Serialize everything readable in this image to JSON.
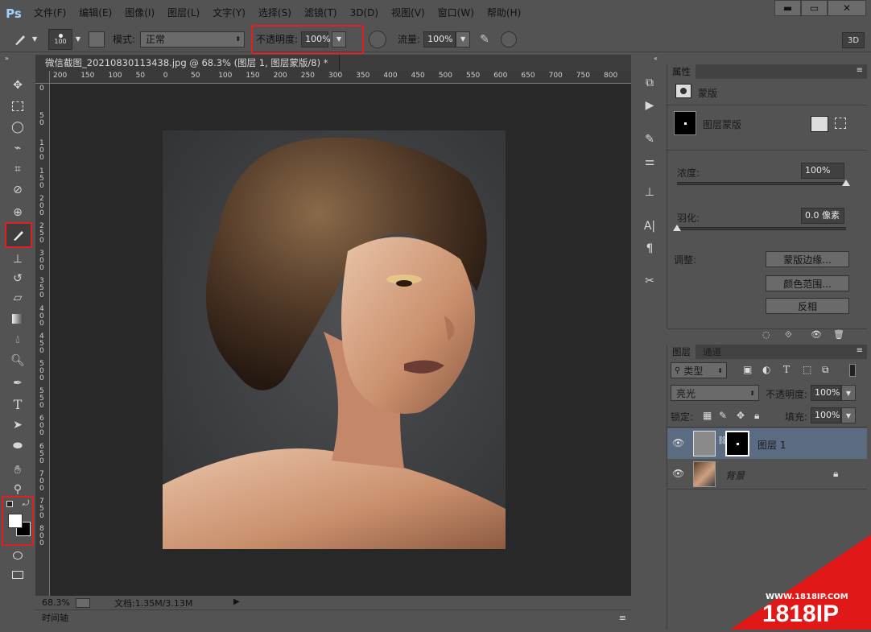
{
  "menubar": {
    "logo": "Ps",
    "items": [
      "文件(F)",
      "编辑(E)",
      "图像(I)",
      "图层(L)",
      "文字(Y)",
      "选择(S)",
      "滤镜(T)",
      "3D(D)",
      "视图(V)",
      "窗口(W)",
      "帮助(H)"
    ],
    "window_buttons": [
      "▬",
      "▭",
      "✕"
    ]
  },
  "options": {
    "brush_size": "100",
    "mode_label": "模式:",
    "mode_value": "正常",
    "opacity_label": "不透明度:",
    "opacity_value": "100%",
    "flow_label": "流量:",
    "flow_value": "100%",
    "mode_3d": "3D"
  },
  "document": {
    "tab_title": "微信截图_20210830113438.jpg @ 68.3% (图层 1, 图层蒙版/8) *",
    "tab_close": "×"
  },
  "ruler": {
    "top_labels": [
      "200",
      "150",
      "100",
      "50",
      "0",
      "50",
      "100",
      "150",
      "200",
      "250",
      "300",
      "350",
      "400",
      "450",
      "500",
      "550",
      "600",
      "650",
      "700",
      "750",
      "800"
    ],
    "left_labels": [
      "0",
      "5\n0",
      "1\n0\n0",
      "1\n5\n0",
      "2\n0\n0",
      "2\n5\n0",
      "3\n0\n0",
      "3\n5\n0",
      "4\n0\n0",
      "4\n5\n0",
      "5\n0\n0",
      "5\n5\n0",
      "6\n0\n0",
      "6\n5\n0",
      "7\n0\n0",
      "7\n5\n0",
      "8\n0\n0"
    ]
  },
  "status": {
    "zoom": "68.3%",
    "doc_info": "文档:1.35M/3.13M",
    "timeline": "时间轴"
  },
  "properties": {
    "tab": "属性",
    "section_title": "蒙版",
    "mask_label": "图层蒙版",
    "density_label": "浓度:",
    "density_value": "100%",
    "density_level": 1.0,
    "feather_label": "羽化:",
    "feather_value": "0.0 像素",
    "feather_level": 0.0,
    "adjust_label": "调整:",
    "btn_mask_edge": "蒙版边缘...",
    "btn_color_range": "颜色范围...",
    "btn_invert": "反相"
  },
  "layers": {
    "tabs": [
      "图层",
      "通道"
    ],
    "filter_kind": "类型",
    "blend_mode": "亮光",
    "opacity_label": "不透明度:",
    "opacity_value": "100%",
    "lock_label": "锁定:",
    "fill_label": "填充:",
    "fill_value": "100%",
    "rows": [
      {
        "name": "图层 1"
      },
      {
        "name": "背景"
      }
    ]
  },
  "watermark": {
    "url": "WWW.1818IP.COM",
    "brand": "1818IP"
  },
  "colors": {
    "highlight": "#e02020",
    "selected_layer": "#5a6b82"
  }
}
